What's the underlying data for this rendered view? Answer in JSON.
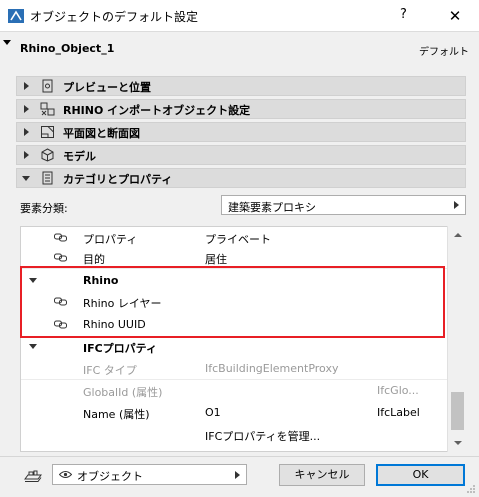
{
  "window": {
    "title": "オブジェクトのデフォルト設定",
    "help": "?",
    "close": "✕"
  },
  "header": {
    "object_name": "Rhino_Object_1",
    "default_label": "デフォルト"
  },
  "sections": [
    {
      "label": "プレビューと位置",
      "icon": "preview-icon",
      "expanded": false
    },
    {
      "label": "RHINO インポートオブジェクト設定",
      "icon": "import-settings-icon",
      "expanded": false
    },
    {
      "label": "平面図と断面図",
      "icon": "floor-plan-icon",
      "expanded": false
    },
    {
      "label": "モデル",
      "icon": "model-cube-icon",
      "expanded": false
    },
    {
      "label": "カテゴリとプロパティ",
      "icon": "document-icon",
      "expanded": true
    }
  ],
  "classification": {
    "label": "要素分類:",
    "value": "建築要素プロキシ"
  },
  "property_list": {
    "rows": [
      {
        "name": "プロパティ",
        "value": "プライベート",
        "extra": ""
      },
      {
        "name": "目的",
        "value": "居住",
        "extra": ""
      },
      {
        "name": "Rhino",
        "value": "",
        "extra": ""
      },
      {
        "name": "Rhino レイヤー",
        "value": "",
        "extra": ""
      },
      {
        "name": "Rhino UUID",
        "value": "",
        "extra": ""
      },
      {
        "name": "IFCプロパティ",
        "value": "",
        "extra": ""
      },
      {
        "name": "IFC タイプ",
        "value": "IfcBuildingElementProxy",
        "extra": ""
      },
      {
        "name": "GlobalId (属性)",
        "value": "",
        "extra": "IfcGlo..."
      },
      {
        "name": "Name (属性)",
        "value": "O1",
        "extra": "IfcLabel"
      },
      {
        "name": "",
        "value": "IFCプロパティを管理...",
        "extra": ""
      }
    ]
  },
  "footer": {
    "view_label": "オブジェクト",
    "cancel_label": "キャンセル",
    "ok_label": "OK"
  },
  "colors": {
    "highlight_border": "#e81f25",
    "ok_border": "#0078d7",
    "section_bg": "#dcdcdc"
  }
}
